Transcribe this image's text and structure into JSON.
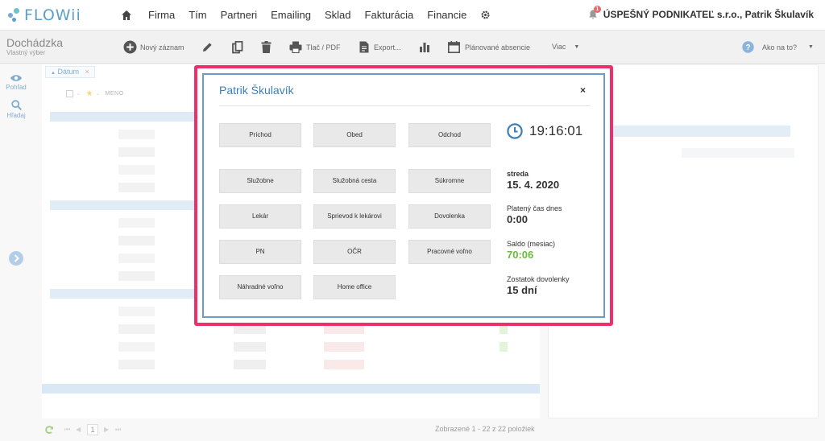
{
  "brand": {
    "name": "FLOWii"
  },
  "nav": {
    "items": [
      "Firma",
      "Tím",
      "Partneri",
      "Emailing",
      "Sklad",
      "Fakturácia",
      "Financie"
    ],
    "company_user": "ÚSPEŠNÝ PODNIKATEĽ s.r.o., Patrik Škulavík",
    "notification_count": "1"
  },
  "toolbar": {
    "title": "Dochádzka",
    "subtitle": "Vlastný výber",
    "new_record": "Nový záznam",
    "print": "Tlač / PDF",
    "export": "Export...",
    "planned_absences": "Plánované absencie",
    "more": "Viac",
    "help": "Ako na to?"
  },
  "rail": {
    "view": "Pohľad",
    "search": "Hľadaj"
  },
  "grid": {
    "filter_chip": "Dátum",
    "column_name": "MENO"
  },
  "pager": {
    "page": "1",
    "summary": "Zobrazené 1 - 22 z 22 položiek"
  },
  "modal": {
    "title": "Patrik Škulavík",
    "close": "×",
    "buttons": [
      [
        "Príchod",
        "Obed",
        "Odchod"
      ],
      [
        "Služobne",
        "Služobná cesta",
        "Súkromne"
      ],
      [
        "Lekár",
        "Sprievod k lekárovi",
        "Dovolenka"
      ],
      [
        "PN",
        "OČR",
        "Pracovné voľno"
      ],
      [
        "Náhradné voľno",
        "Home office"
      ]
    ],
    "clock": "19:16:01",
    "day_name": "streda",
    "date": "15. 4. 2020",
    "paid_time_label": "Platený čas dnes",
    "paid_time": "0:00",
    "balance_label": "Saldo (mesiac)",
    "balance": "70:06",
    "vacation_label": "Zostatok dovolenky",
    "vacation": "15 dní"
  },
  "colors": {
    "accent": "#3d7fb5",
    "highlight_frame": "#ef2f6c",
    "positive": "#6abb3b"
  }
}
